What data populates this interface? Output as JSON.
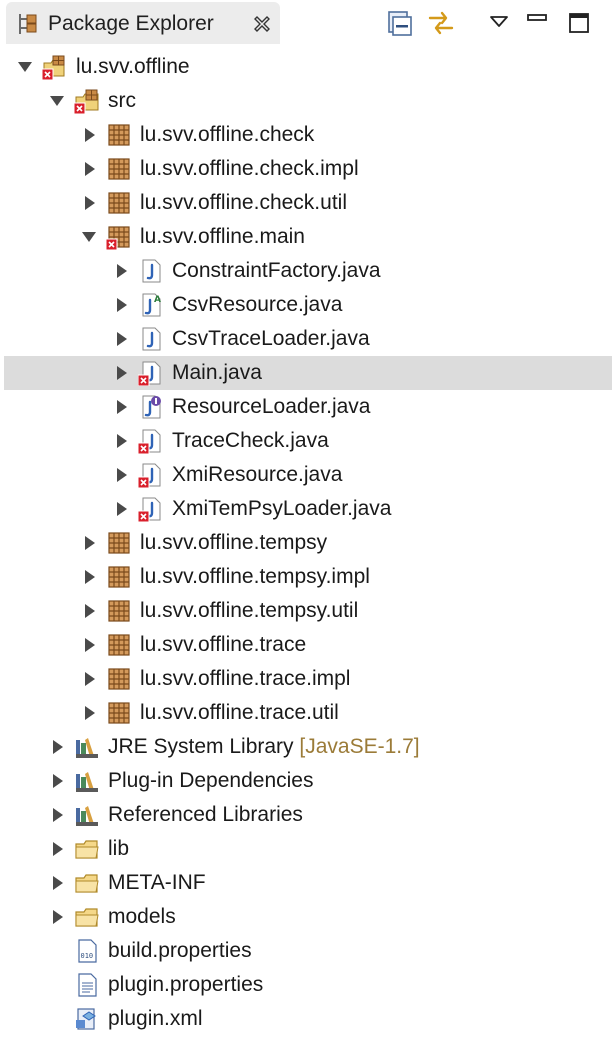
{
  "view": {
    "title": "Package Explorer",
    "icons": {
      "tab": "package-explorer-icon",
      "close": "close-icon",
      "collapse_all": "collapse-all-icon",
      "link_with_editor": "link-with-editor-icon",
      "view_menu": "view-menu-icon",
      "minimize": "minimize-icon",
      "maximize": "maximize-icon"
    }
  },
  "colors": {
    "selection": "#dcdcdc",
    "decoration": "#9b7b38",
    "error": "#d9202c",
    "package": "#a8662d",
    "java": "#2f63b6",
    "folder": "#e0b24a"
  },
  "tree": [
    {
      "label": "lu.svv.offline",
      "icon": "project",
      "level": 0,
      "expanded": true,
      "error": true
    },
    {
      "label": "src",
      "icon": "source-folder",
      "level": 1,
      "expanded": true,
      "error": true
    },
    {
      "label": "lu.svv.offline.check",
      "icon": "package",
      "level": 2,
      "expanded": false
    },
    {
      "label": "lu.svv.offline.check.impl",
      "icon": "package",
      "level": 2,
      "expanded": false
    },
    {
      "label": "lu.svv.offline.check.util",
      "icon": "package",
      "level": 2,
      "expanded": false
    },
    {
      "label": "lu.svv.offline.main",
      "icon": "package",
      "level": 2,
      "expanded": true,
      "error": true
    },
    {
      "label": "ConstraintFactory.java",
      "icon": "java-file",
      "level": 3,
      "expanded": false
    },
    {
      "label": "CsvResource.java",
      "icon": "java-file-abstract",
      "level": 3,
      "expanded": false
    },
    {
      "label": "CsvTraceLoader.java",
      "icon": "java-file",
      "level": 3,
      "expanded": false
    },
    {
      "label": "Main.java",
      "icon": "java-file",
      "level": 3,
      "expanded": false,
      "error": true,
      "selected": true
    },
    {
      "label": "ResourceLoader.java",
      "icon": "java-interface",
      "level": 3,
      "expanded": false
    },
    {
      "label": "TraceCheck.java",
      "icon": "java-file",
      "level": 3,
      "expanded": false,
      "error": true
    },
    {
      "label": "XmiResource.java",
      "icon": "java-file",
      "level": 3,
      "expanded": false,
      "error": true
    },
    {
      "label": "XmiTemPsyLoader.java",
      "icon": "java-file",
      "level": 3,
      "expanded": false,
      "error": true
    },
    {
      "label": "lu.svv.offline.tempsy",
      "icon": "package",
      "level": 2,
      "expanded": false
    },
    {
      "label": "lu.svv.offline.tempsy.impl",
      "icon": "package",
      "level": 2,
      "expanded": false
    },
    {
      "label": "lu.svv.offline.tempsy.util",
      "icon": "package",
      "level": 2,
      "expanded": false
    },
    {
      "label": "lu.svv.offline.trace",
      "icon": "package",
      "level": 2,
      "expanded": false
    },
    {
      "label": "lu.svv.offline.trace.impl",
      "icon": "package",
      "level": 2,
      "expanded": false
    },
    {
      "label": "lu.svv.offline.trace.util",
      "icon": "package",
      "level": 2,
      "expanded": false
    },
    {
      "label": "JRE System Library",
      "decoration": "[JavaSE-1.7]",
      "icon": "library",
      "level": 1,
      "expanded": false
    },
    {
      "label": "Plug-in Dependencies",
      "icon": "library",
      "level": 1,
      "expanded": false
    },
    {
      "label": "Referenced Libraries",
      "icon": "library",
      "level": 1,
      "expanded": false
    },
    {
      "label": "lib",
      "icon": "folder",
      "level": 1,
      "expanded": false
    },
    {
      "label": "META-INF",
      "icon": "folder",
      "level": 1,
      "expanded": false
    },
    {
      "label": "models",
      "icon": "folder",
      "level": 1,
      "expanded": false
    },
    {
      "label": "build.properties",
      "icon": "properties-file",
      "level": 1,
      "leaf": true
    },
    {
      "label": "plugin.properties",
      "icon": "text-file",
      "level": 1,
      "leaf": true
    },
    {
      "label": "plugin.xml",
      "icon": "plugin-xml-file",
      "level": 1,
      "leaf": true
    }
  ]
}
